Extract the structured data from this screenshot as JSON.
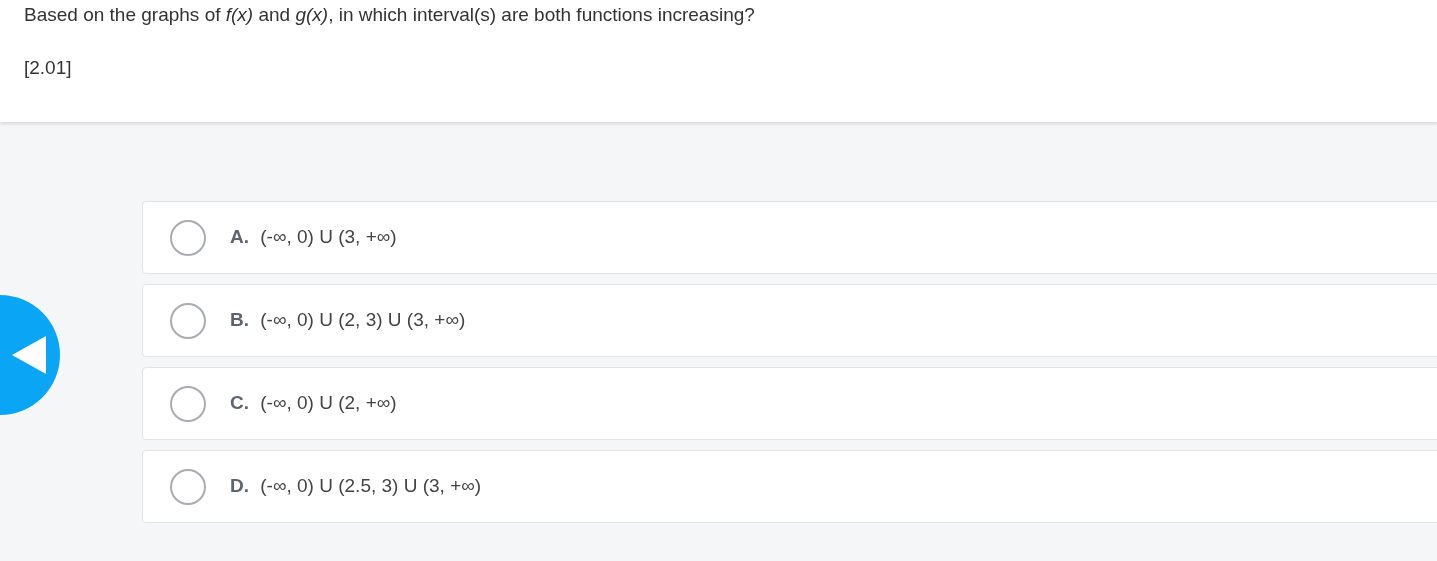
{
  "question": {
    "text": "Based on the graphs of *f(x)* and *g(x)*, in which interval(s) are both functions increasing?",
    "code": "[2.01]"
  },
  "options": [
    {
      "letter": "A.",
      "text": "(-∞, 0) U (3, +∞)",
      "selected": false
    },
    {
      "letter": "B.",
      "text": "(-∞, 0) U (2, 3) U (3, +∞)",
      "selected": false
    },
    {
      "letter": "C.",
      "text": "(-∞, 0) U (2, +∞)",
      "selected": false
    },
    {
      "letter": "D.",
      "text": "(-∞, 0) U (2.5, 3) U (3, +∞)",
      "selected": false
    }
  ]
}
